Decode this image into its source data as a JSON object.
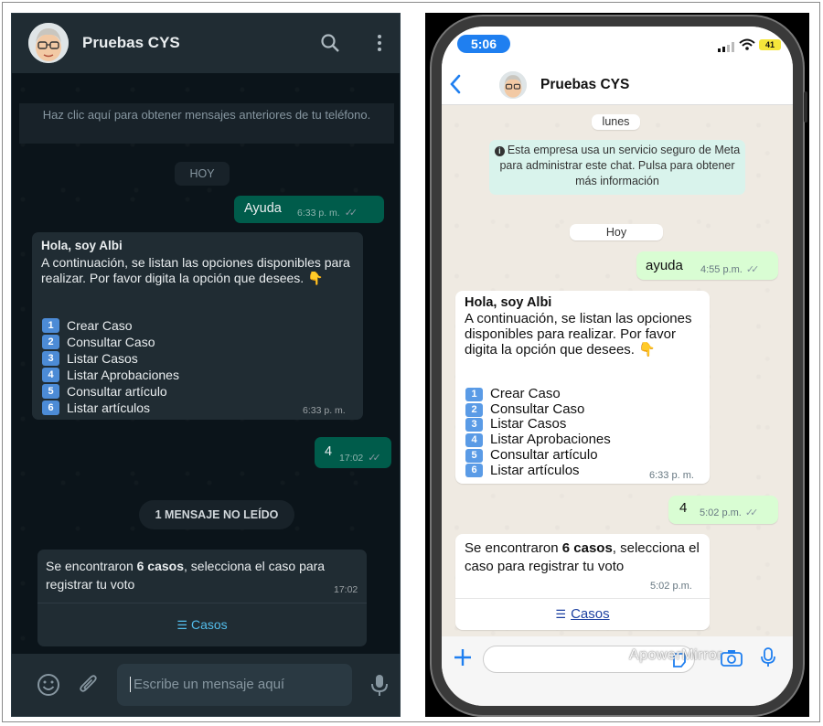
{
  "desktop": {
    "header": {
      "title": "Pruebas CYS"
    },
    "older_notice": "Haz clic aquí para obtener mensajes anteriores de tu teléfono.",
    "date_divider": "HOY",
    "msg_out_1": {
      "text": "Ayuda",
      "time": "6:33 p. m."
    },
    "msg_in_1": {
      "greeting": "Hola, soy Albi",
      "body": "A continuación, se listan las opciones disponibles para realizar. Por favor digita la opción que desees.",
      "emoji": "👇",
      "options": [
        "Crear Caso",
        "Consultar Caso",
        "Listar Casos",
        "Listar Aprobaciones",
        "Consultar artículo",
        "Listar artículos"
      ],
      "keycaps": [
        "1",
        "2",
        "3",
        "4",
        "5",
        "6"
      ],
      "time": "6:33 p. m."
    },
    "msg_out_2": {
      "text": "4",
      "time": "17:02"
    },
    "unread_divider": "1 MENSAJE NO LEÍDO",
    "msg_in_2": {
      "text_prefix": "Se encontraron ",
      "text_bold": "6 casos",
      "text_suffix": ", selecciona el caso para registrar tu voto",
      "time": "17:02",
      "list_button": "Casos"
    },
    "composer": {
      "placeholder": "Escribe un mensaje aquí"
    }
  },
  "mobile": {
    "status_time": "5:06",
    "battery": "41",
    "header": {
      "title": "Pruebas CYS"
    },
    "date_divider_1": "lunes",
    "info_notice": "Esta empresa usa un servicio seguro de Meta para administrar este chat. Pulsa para obtener más información",
    "date_divider_2": "Hoy",
    "msg_out_1": {
      "text": "ayuda",
      "time": "4:55 p.m."
    },
    "msg_in_1": {
      "greeting": "Hola, soy Albi",
      "body": "A continuación, se listan las opciones disponibles para realizar. Por favor digita la opción que desees.",
      "emoji": "👇",
      "options": [
        "Crear Caso",
        "Consultar Caso",
        "Listar Casos",
        "Listar Aprobaciones",
        "Consultar artículo",
        "Listar artículos"
      ],
      "keycaps": [
        "1",
        "2",
        "3",
        "4",
        "5",
        "6"
      ],
      "time": "6:33 p. m."
    },
    "msg_out_2": {
      "text": "4",
      "time": "5:02 p.m."
    },
    "msg_in_2": {
      "text_prefix": "Se encontraron ",
      "text_bold": "6 casos",
      "text_suffix": ", selecciona el caso para registrar tu voto",
      "time": "5:02 p.m.",
      "list_button": "Casos"
    },
    "watermark": "ApowerMirror"
  },
  "colors": {
    "dark_bg": "#0b141a",
    "dark_header": "#202c33",
    "dark_out_bubble": "#005c4b",
    "light_out_bubble": "#d9fdd3",
    "link_blue": "#53bdeb",
    "ios_blue": "#1f7ff0"
  }
}
